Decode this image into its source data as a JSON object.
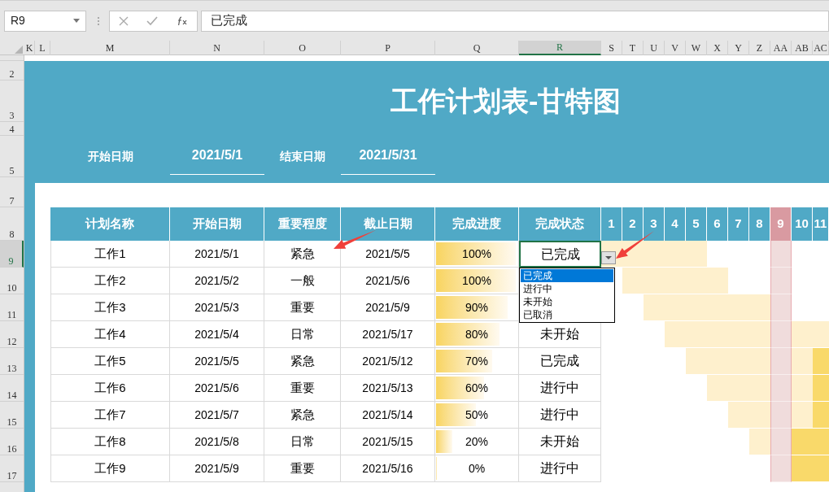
{
  "formula_bar": {
    "name_box": "R9",
    "formula": "已完成"
  },
  "columns": [
    {
      "label": "K",
      "selected": false
    },
    {
      "label": "L",
      "selected": false
    },
    {
      "label": "M",
      "selected": false
    },
    {
      "label": "N",
      "selected": false
    },
    {
      "label": "O",
      "selected": false
    },
    {
      "label": "P",
      "selected": false
    },
    {
      "label": "Q",
      "selected": false
    },
    {
      "label": "R",
      "selected": true
    },
    {
      "label": "S",
      "selected": false
    },
    {
      "label": "T",
      "selected": false
    },
    {
      "label": "U",
      "selected": false
    },
    {
      "label": "V",
      "selected": false
    },
    {
      "label": "W",
      "selected": false
    },
    {
      "label": "X",
      "selected": false
    },
    {
      "label": "Y",
      "selected": false
    },
    {
      "label": "Z",
      "selected": false
    },
    {
      "label": "AA",
      "selected": false
    },
    {
      "label": "AB",
      "selected": false
    },
    {
      "label": "AC",
      "selected": false
    }
  ],
  "row_numbers": [
    {
      "label": "2",
      "selected": false
    },
    {
      "label": "3",
      "selected": false
    },
    {
      "label": "4",
      "selected": false
    },
    {
      "label": "5",
      "selected": false
    },
    {
      "label": "7",
      "selected": false
    },
    {
      "label": "8",
      "selected": false
    },
    {
      "label": "9",
      "selected": true
    },
    {
      "label": "10",
      "selected": false
    },
    {
      "label": "11",
      "selected": false
    },
    {
      "label": "12",
      "selected": false
    },
    {
      "label": "13",
      "selected": false
    },
    {
      "label": "14",
      "selected": false
    },
    {
      "label": "15",
      "selected": false
    },
    {
      "label": "16",
      "selected": false
    },
    {
      "label": "17",
      "selected": false
    }
  ],
  "title": "工作计划表-甘特图",
  "period": [
    {
      "label": "开始日期",
      "value": "2021/5/1"
    },
    {
      "label": "结束日期",
      "value": "2021/5/31"
    }
  ],
  "table": {
    "columns": [
      "计划名称",
      "开始日期",
      "重要程度",
      "截止日期",
      "完成进度",
      "完成状态"
    ],
    "days": [
      {
        "label": "1",
        "highlighted": false
      },
      {
        "label": "2",
        "highlighted": false
      },
      {
        "label": "3",
        "highlighted": false
      },
      {
        "label": "4",
        "highlighted": false
      },
      {
        "label": "5",
        "highlighted": false
      },
      {
        "label": "6",
        "highlighted": false
      },
      {
        "label": "7",
        "highlighted": false
      },
      {
        "label": "8",
        "highlighted": false
      },
      {
        "label": "9",
        "highlighted": true
      },
      {
        "label": "10",
        "highlighted": false
      },
      {
        "label": "11",
        "highlighted": false
      }
    ],
    "rows": [
      {
        "name": "工作1",
        "start": "2021/5/1",
        "priority": "紧急",
        "due": "2021/5/5",
        "progress": "100%",
        "level": 1,
        "status": "已完成",
        "selected": true,
        "timeline": [
          {
            "kind": "planned"
          },
          {
            "kind": "planned"
          },
          {
            "kind": "planned"
          },
          {
            "kind": "planned"
          },
          {
            "kind": "planned"
          },
          {
            "kind": "none"
          },
          {
            "kind": "none"
          },
          {
            "kind": "none"
          },
          {
            "kind": "none"
          },
          {
            "kind": "none"
          },
          {
            "kind": "none"
          }
        ]
      },
      {
        "name": "工作2",
        "start": "2021/5/2",
        "priority": "一般",
        "due": "2021/5/6",
        "progress": "100%",
        "level": 1,
        "timeline": [
          {
            "kind": "none"
          },
          {
            "kind": "planned"
          },
          {
            "kind": "planned"
          },
          {
            "kind": "planned"
          },
          {
            "kind": "planned"
          },
          {
            "kind": "planned"
          },
          {
            "kind": "none"
          },
          {
            "kind": "none"
          },
          {
            "kind": "none"
          },
          {
            "kind": "none"
          },
          {
            "kind": "none"
          }
        ]
      },
      {
        "name": "工作3",
        "start": "2021/5/3",
        "priority": "重要",
        "due": "2021/5/9",
        "progress": "90%",
        "level": 0.9,
        "timeline": [
          {
            "kind": "none"
          },
          {
            "kind": "none"
          },
          {
            "kind": "planned"
          },
          {
            "kind": "planned"
          },
          {
            "kind": "planned"
          },
          {
            "kind": "planned"
          },
          {
            "kind": "planned"
          },
          {
            "kind": "planned"
          },
          {
            "kind": "none"
          },
          {
            "kind": "none"
          },
          {
            "kind": "none"
          }
        ]
      },
      {
        "name": "工作4",
        "start": "2021/5/4",
        "priority": "日常",
        "due": "2021/5/17",
        "progress": "80%",
        "level": 0.8,
        "status": "未开始",
        "selected": false,
        "timeline": [
          {
            "kind": "none"
          },
          {
            "kind": "none"
          },
          {
            "kind": "none"
          },
          {
            "kind": "planned"
          },
          {
            "kind": "planned"
          },
          {
            "kind": "planned"
          },
          {
            "kind": "planned"
          },
          {
            "kind": "planned"
          },
          {
            "kind": "none"
          },
          {
            "kind": "planned"
          },
          {
            "kind": "planned"
          }
        ]
      },
      {
        "name": "工作5",
        "start": "2021/5/5",
        "priority": "紧急",
        "due": "2021/5/12",
        "progress": "70%",
        "level": 0.7,
        "status": "已完成",
        "selected": false,
        "timeline": [
          {
            "kind": "none"
          },
          {
            "kind": "none"
          },
          {
            "kind": "none"
          },
          {
            "kind": "none"
          },
          {
            "kind": "planned"
          },
          {
            "kind": "planned"
          },
          {
            "kind": "planned"
          },
          {
            "kind": "planned"
          },
          {
            "kind": "none"
          },
          {
            "kind": "planned"
          },
          {
            "kind": "done"
          }
        ]
      },
      {
        "name": "工作6",
        "start": "2021/5/6",
        "priority": "重要",
        "due": "2021/5/13",
        "progress": "60%",
        "level": 0.6,
        "status": "进行中",
        "selected": false,
        "timeline": [
          {
            "kind": "none"
          },
          {
            "kind": "none"
          },
          {
            "kind": "none"
          },
          {
            "kind": "none"
          },
          {
            "kind": "none"
          },
          {
            "kind": "planned"
          },
          {
            "kind": "planned"
          },
          {
            "kind": "planned"
          },
          {
            "kind": "none"
          },
          {
            "kind": "planned"
          },
          {
            "kind": "done"
          }
        ]
      },
      {
        "name": "工作7",
        "start": "2021/5/7",
        "priority": "紧急",
        "due": "2021/5/14",
        "progress": "50%",
        "level": 0.5,
        "status": "进行中",
        "selected": false,
        "timeline": [
          {
            "kind": "none"
          },
          {
            "kind": "none"
          },
          {
            "kind": "none"
          },
          {
            "kind": "none"
          },
          {
            "kind": "none"
          },
          {
            "kind": "none"
          },
          {
            "kind": "planned"
          },
          {
            "kind": "planned"
          },
          {
            "kind": "none"
          },
          {
            "kind": "planned"
          },
          {
            "kind": "done"
          }
        ]
      },
      {
        "name": "工作8",
        "start": "2021/5/8",
        "priority": "日常",
        "due": "2021/5/15",
        "progress": "20%",
        "level": 0.2,
        "status": "未开始",
        "selected": false,
        "timeline": [
          {
            "kind": "none"
          },
          {
            "kind": "none"
          },
          {
            "kind": "none"
          },
          {
            "kind": "none"
          },
          {
            "kind": "none"
          },
          {
            "kind": "none"
          },
          {
            "kind": "none"
          },
          {
            "kind": "planned"
          },
          {
            "kind": "none"
          },
          {
            "kind": "done"
          },
          {
            "kind": "done"
          }
        ]
      },
      {
        "name": "工作9",
        "start": "2021/5/9",
        "priority": "重要",
        "due": "2021/5/16",
        "progress": "0%",
        "level": 0,
        "status": "进行中",
        "selected": false,
        "timeline": [
          {
            "kind": "none"
          },
          {
            "kind": "none"
          },
          {
            "kind": "none"
          },
          {
            "kind": "none"
          },
          {
            "kind": "none"
          },
          {
            "kind": "none"
          },
          {
            "kind": "none"
          },
          {
            "kind": "none"
          },
          {
            "kind": "none"
          },
          {
            "kind": "done"
          },
          {
            "kind": "done"
          }
        ]
      }
    ]
  },
  "dropdown": {
    "options": [
      {
        "label": "已完成",
        "selected": true
      },
      {
        "label": "进行中",
        "selected": false
      },
      {
        "label": "未开始",
        "selected": false
      },
      {
        "label": "已取消",
        "selected": false
      }
    ]
  }
}
